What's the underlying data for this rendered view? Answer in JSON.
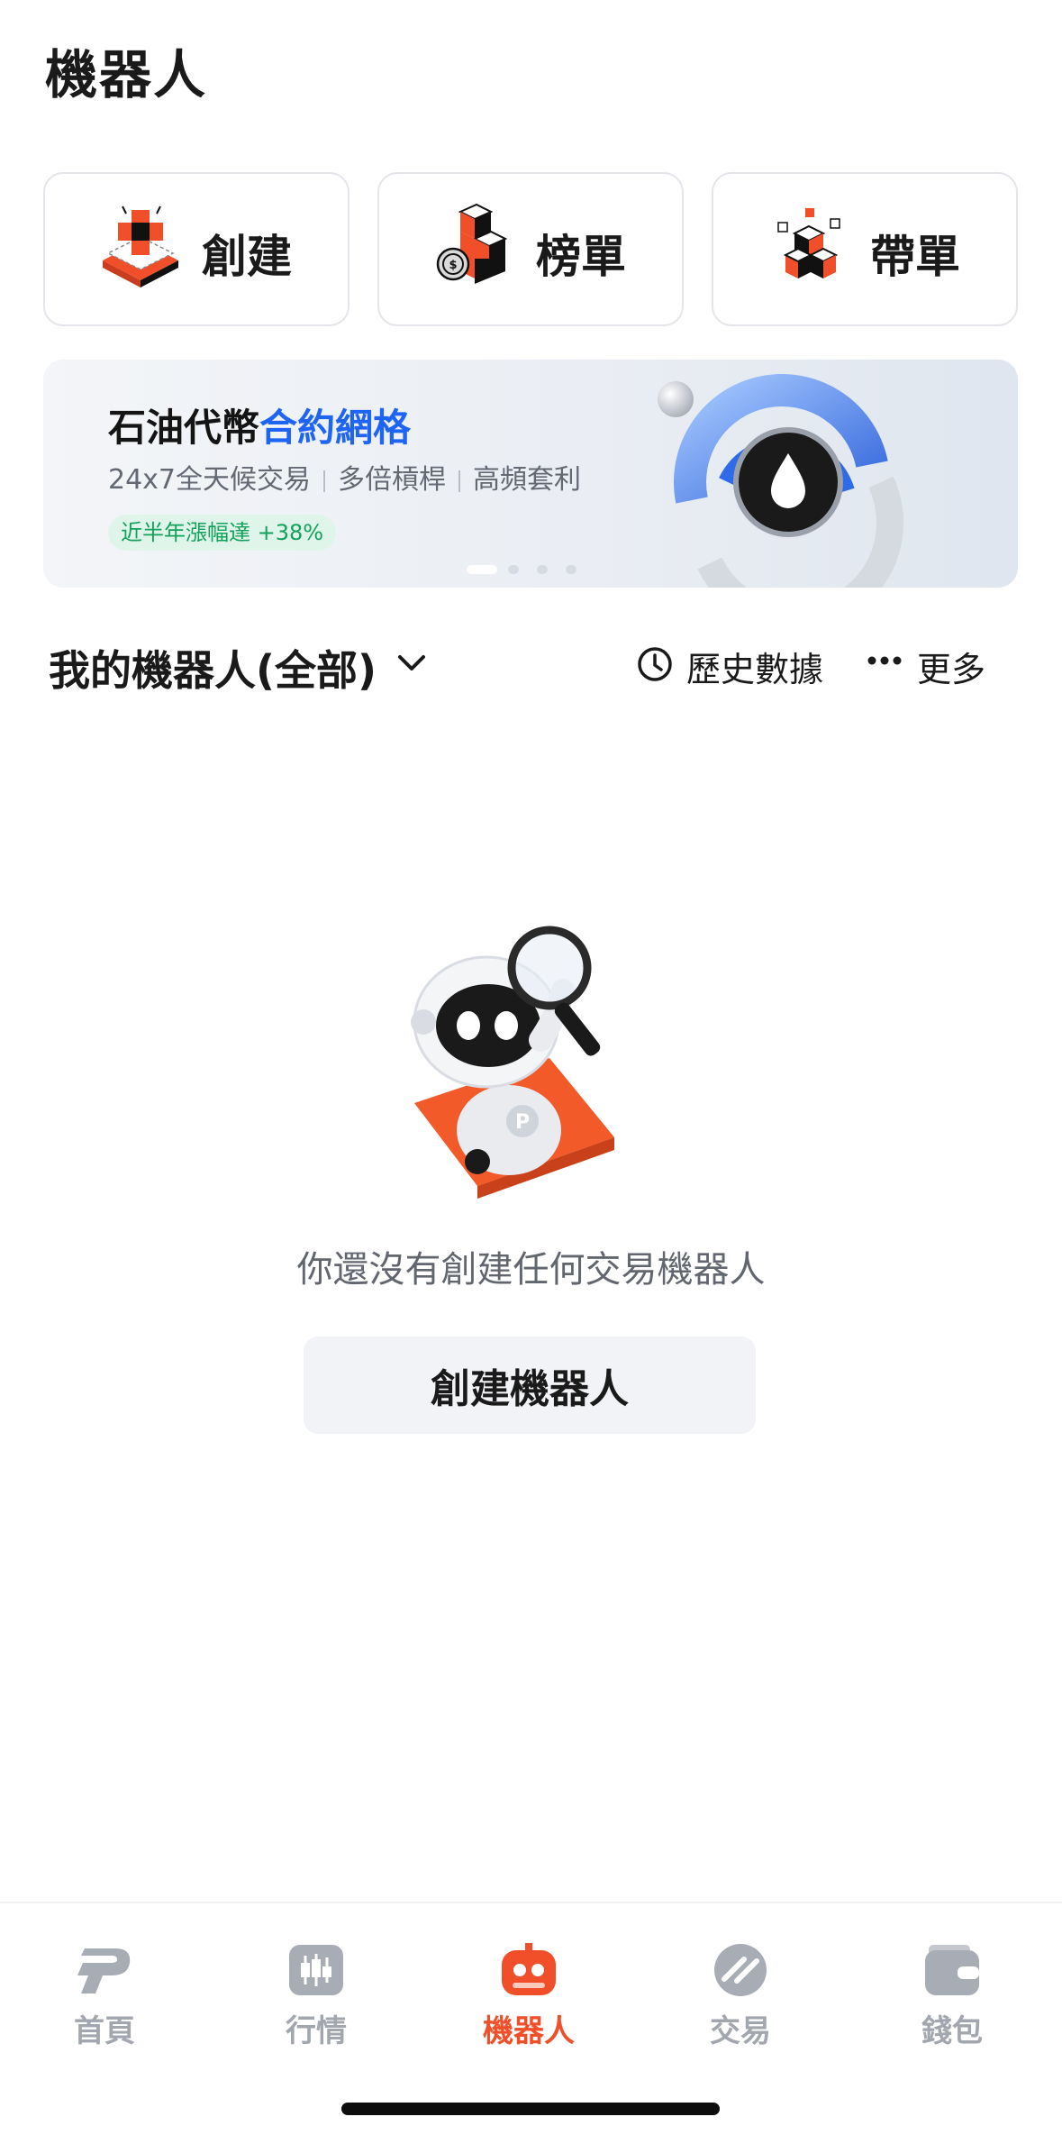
{
  "page": {
    "title": "機器人"
  },
  "actions": [
    {
      "label": "創建",
      "icon": "create-plus-icon"
    },
    {
      "label": "榜單",
      "icon": "leaderboard-icon"
    },
    {
      "label": "帶單",
      "icon": "copy-trade-icon"
    }
  ],
  "banner": {
    "title_part1": "石油代幣",
    "title_highlight": "合約網格",
    "subtitle_items": [
      "24x7全天候交易",
      "多倍槓桿",
      "高頻套利"
    ],
    "tag": "近半年漲幅達 +38%",
    "slides_total": 4,
    "active_slide": 1,
    "accent_color": "#1e64f5"
  },
  "my_robots": {
    "title": "我的機器人(全部)",
    "history_label": "歷史數據",
    "more_label": "更多"
  },
  "empty_state": {
    "message": "你還沒有創建任何交易機器人",
    "button_label": "創建機器人"
  },
  "tabbar": {
    "active_color": "#f04f2a",
    "items": [
      {
        "label": "首頁",
        "icon": "home-logo-icon",
        "active": false
      },
      {
        "label": "行情",
        "icon": "market-candles-icon",
        "active": false
      },
      {
        "label": "機器人",
        "icon": "robot-icon",
        "active": true
      },
      {
        "label": "交易",
        "icon": "trade-icon",
        "active": false
      },
      {
        "label": "錢包",
        "icon": "wallet-icon",
        "active": false
      }
    ]
  }
}
